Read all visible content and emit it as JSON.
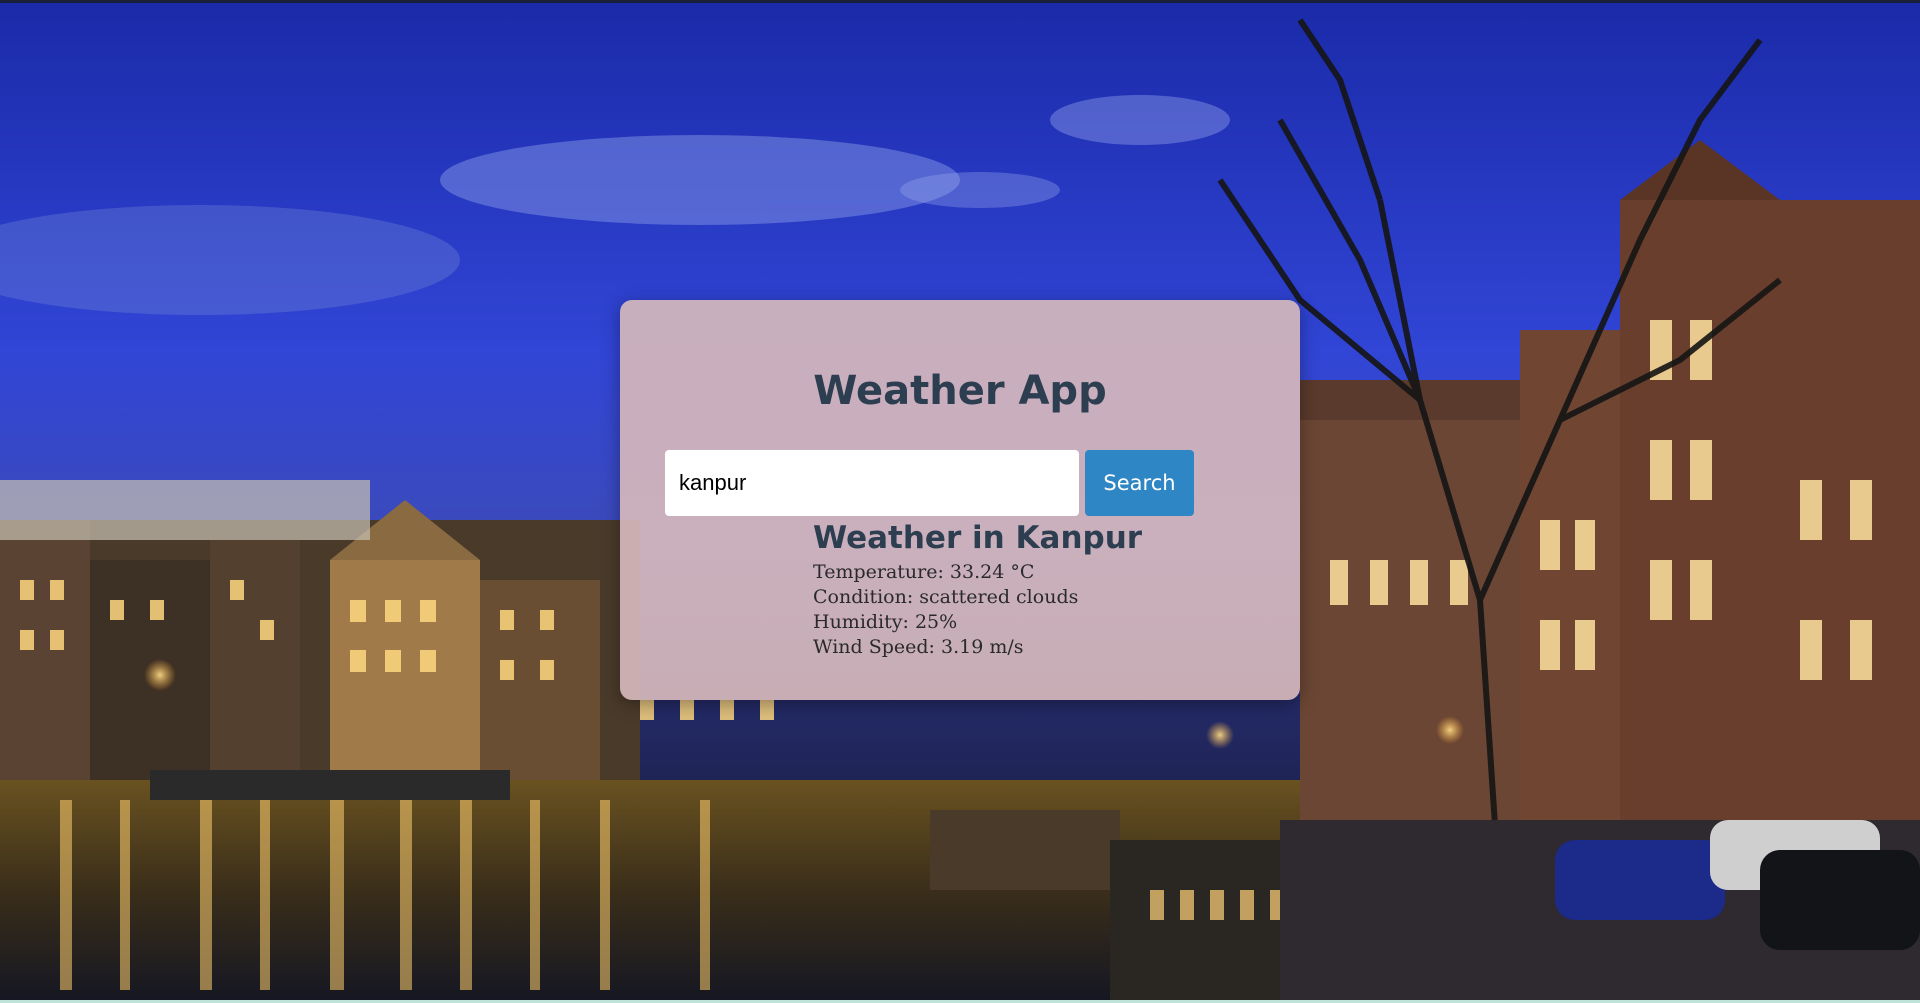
{
  "app": {
    "title": "Weather App"
  },
  "search": {
    "value": "kanpur",
    "button_label": "Search"
  },
  "result": {
    "heading": "Weather in Kanpur",
    "temperature": "Temperature: 33.24 °C",
    "condition": "Condition: scattered clouds",
    "humidity": "Humidity: 25%",
    "wind": "Wind Speed: 3.19 m/s"
  }
}
